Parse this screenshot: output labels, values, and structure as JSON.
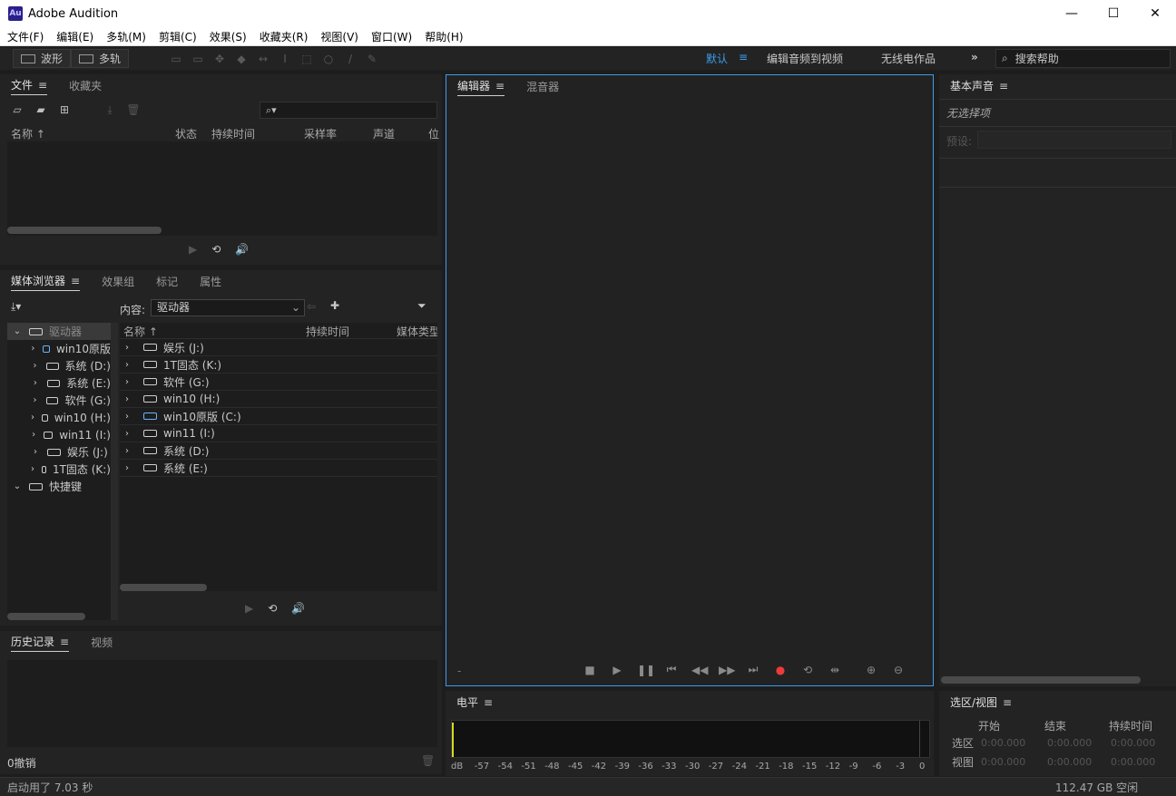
{
  "window": {
    "logo": "Au",
    "title": "Adobe Audition",
    "minimize": "—",
    "maximize": "☐",
    "close": "✕"
  },
  "menu": [
    "文件(F)",
    "编辑(E)",
    "多轨(M)",
    "剪辑(C)",
    "效果(S)",
    "收藏夹(R)",
    "视图(V)",
    "窗口(W)",
    "帮助(H)"
  ],
  "toolbar": {
    "waveform_label": "波形",
    "multitrack_label": "多轨",
    "workspaces": {
      "default": "默认",
      "menu_glyph": "≡",
      "edit_video": "编辑音频到视频",
      "radio": "无线电作品",
      "more": "»"
    },
    "search_help": "搜索帮助"
  },
  "files_panel": {
    "tabs": [
      {
        "label": "文件",
        "menu": "≡"
      },
      {
        "label": "收藏夹"
      }
    ],
    "search_glyph": "⌕▾",
    "columns": [
      "名称 ↑",
      "状态",
      "持续时间",
      "采样率",
      "声道",
      "位"
    ]
  },
  "media_panel": {
    "tabs": [
      {
        "label": "媒体浏览器",
        "menu": "≡"
      },
      {
        "label": "效果组"
      },
      {
        "label": "标记"
      },
      {
        "label": "属性"
      }
    ],
    "content_label": "内容:",
    "content_value": "驱动器",
    "tree": [
      {
        "label": "驱动器",
        "expanded": true,
        "indent": 0
      },
      {
        "label": "win10原版",
        "indent": 1,
        "win": true
      },
      {
        "label": "系统 (D:)",
        "indent": 1
      },
      {
        "label": "系统 (E:)",
        "indent": 1
      },
      {
        "label": "软件 (G:)",
        "indent": 1
      },
      {
        "label": "win10 (H:)",
        "indent": 1
      },
      {
        "label": "win11 (I:)",
        "indent": 1
      },
      {
        "label": "娱乐 (J:)",
        "indent": 1
      },
      {
        "label": "1T固态 (K:)",
        "indent": 1
      },
      {
        "label": "快捷键",
        "expanded": true,
        "indent": 0
      }
    ],
    "columns": [
      "名称 ↑",
      "持续时间",
      "媒体类型"
    ],
    "rows": [
      {
        "label": "娱乐 (J:)"
      },
      {
        "label": "1T固态 (K:)"
      },
      {
        "label": "软件 (G:)"
      },
      {
        "label": "win10 (H:)"
      },
      {
        "label": "win10原版 (C:)",
        "win": true
      },
      {
        "label": "win11 (I:)"
      },
      {
        "label": "系统 (D:)"
      },
      {
        "label": "系统 (E:)"
      }
    ]
  },
  "history_panel": {
    "tabs": [
      {
        "label": "历史记录",
        "menu": "≡"
      },
      {
        "label": "视频"
      }
    ],
    "undo_count": "0撤销"
  },
  "editor_panel": {
    "tabs": [
      {
        "label": "编辑器",
        "menu": "≡"
      },
      {
        "label": "混音器"
      }
    ],
    "dash": "-"
  },
  "basic_sound_panel": {
    "tabs": [
      {
        "label": "基本声音",
        "menu": "≡"
      }
    ],
    "no_selection": "无选择项",
    "preset_label": "预设:"
  },
  "levels_panel": {
    "tabs": [
      {
        "label": "电平",
        "menu": "≡"
      }
    ],
    "scale": [
      "dB",
      "-57",
      "-54",
      "-51",
      "-48",
      "-45",
      "-42",
      "-39",
      "-36",
      "-33",
      "-30",
      "-27",
      "-24",
      "-21",
      "-18",
      "-15",
      "-12",
      "-9",
      "-6",
      "-3",
      "0"
    ]
  },
  "selection_panel": {
    "tabs": [
      {
        "label": "选区/视图",
        "menu": "≡"
      }
    ],
    "col_start": "开始",
    "col_end": "结束",
    "col_duration": "持续时间",
    "row_selection": "选区",
    "row_view": "视图",
    "selection": {
      "start": "0:00.000",
      "end": "0:00.000",
      "duration": "0:00.000"
    },
    "view": {
      "start": "0:00.000",
      "end": "0:00.000",
      "duration": "0:00.000"
    }
  },
  "status": {
    "left": "启动用了 7.03 秒",
    "right": "112.47 GB 空闲"
  },
  "colors": {
    "accent": "#3c9cf0",
    "record": "#ec3b3b",
    "meter_marker": "#d8d820"
  }
}
